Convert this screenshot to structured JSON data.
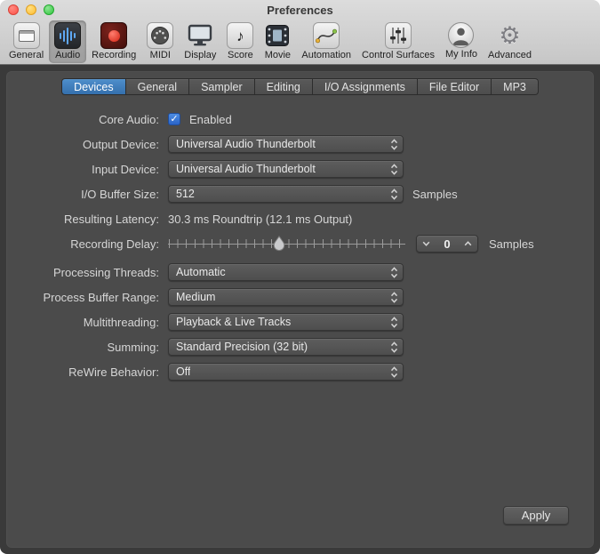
{
  "window": {
    "title": "Preferences"
  },
  "toolbar": {
    "items": [
      {
        "label": "General",
        "selected": false
      },
      {
        "label": "Audio",
        "selected": true
      },
      {
        "label": "Recording",
        "selected": false
      },
      {
        "label": "MIDI",
        "selected": false
      },
      {
        "label": "Display",
        "selected": false
      },
      {
        "label": "Score",
        "selected": false
      },
      {
        "label": "Movie",
        "selected": false
      },
      {
        "label": "Automation",
        "selected": false
      },
      {
        "label": "Control Surfaces",
        "selected": false
      },
      {
        "label": "My Info",
        "selected": false
      },
      {
        "label": "Advanced",
        "selected": false
      }
    ]
  },
  "tabs": {
    "items": [
      {
        "label": "Devices",
        "selected": true
      },
      {
        "label": "General",
        "selected": false
      },
      {
        "label": "Sampler",
        "selected": false
      },
      {
        "label": "Editing",
        "selected": false
      },
      {
        "label": "I/O Assignments",
        "selected": false
      },
      {
        "label": "File Editor",
        "selected": false
      },
      {
        "label": "MP3",
        "selected": false
      }
    ]
  },
  "form": {
    "core_audio": {
      "label": "Core Audio:",
      "checkbox_label": "Enabled",
      "checked": true
    },
    "output_device": {
      "label": "Output Device:",
      "value": "Universal Audio Thunderbolt"
    },
    "input_device": {
      "label": "Input Device:",
      "value": "Universal Audio Thunderbolt"
    },
    "io_buffer_size": {
      "label": "I/O Buffer Size:",
      "value": "512",
      "unit": "Samples"
    },
    "resulting_latency": {
      "label": "Resulting Latency:",
      "value": "30.3 ms Roundtrip (12.1 ms Output)"
    },
    "recording_delay": {
      "label": "Recording Delay:",
      "value": "0",
      "unit": "Samples",
      "slider_percent": 47
    },
    "processing_threads": {
      "label": "Processing Threads:",
      "value": "Automatic"
    },
    "process_buffer_range": {
      "label": "Process Buffer Range:",
      "value": "Medium"
    },
    "multithreading": {
      "label": "Multithreading:",
      "value": "Playback & Live Tracks"
    },
    "summing": {
      "label": "Summing:",
      "value": "Standard Precision (32 bit)"
    },
    "rewire_behavior": {
      "label": "ReWire Behavior:",
      "value": "Off"
    }
  },
  "footer": {
    "apply_label": "Apply"
  },
  "icons": {
    "score_glyph": "♪",
    "advanced_glyph": "⚙",
    "checkmark_glyph": "✓"
  },
  "colors": {
    "tab_selected": "#3d7dbd",
    "checkbox_blue": "#2a64c8",
    "record_red": "#d32313",
    "panel": "#4b4b4b"
  }
}
